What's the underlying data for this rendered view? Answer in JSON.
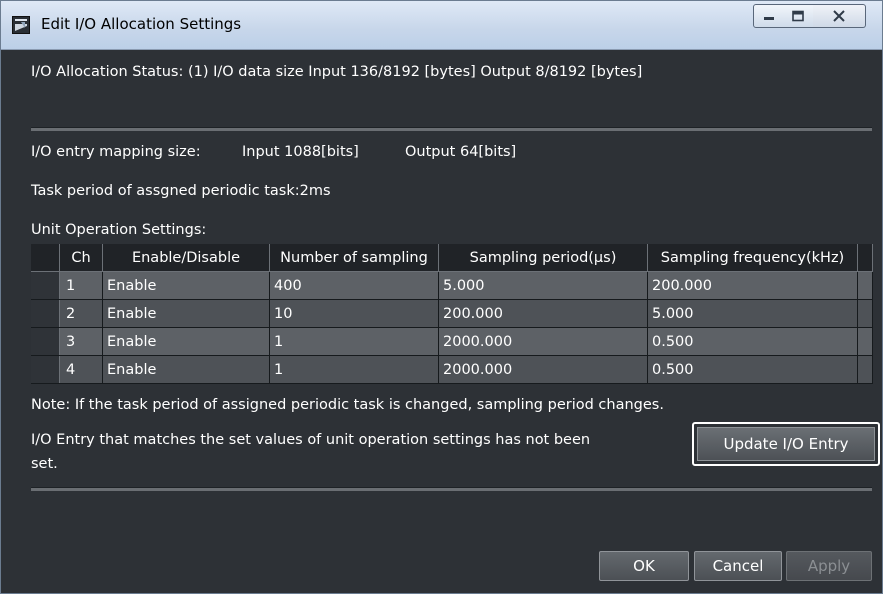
{
  "window": {
    "title": "Edit I/O Allocation Settings",
    "controls": [
      "minimize",
      "maximize",
      "close"
    ]
  },
  "status_line": "I/O Allocation Status: (1) I/O data size Input 136/8192 [bytes] Output 8/8192 [bytes]",
  "mapping": {
    "label": "I/O entry mapping size:",
    "input": "Input 1088[bits]",
    "output": "Output 64[bits]"
  },
  "task_period": "Task period of assgned periodic task:2ms",
  "unit_settings_label": "Unit Operation Settings:",
  "table": {
    "columns": [
      "Ch",
      "Enable/Disable",
      "Number of sampling",
      "Sampling period(μs)",
      "Sampling frequency(kHz)"
    ],
    "rows": [
      {
        "ch": "1",
        "enable": "Enable",
        "samples": "400",
        "period": "5.000",
        "freq": "200.000"
      },
      {
        "ch": "2",
        "enable": "Enable",
        "samples": "10",
        "period": "200.000",
        "freq": "5.000"
      },
      {
        "ch": "3",
        "enable": "Enable",
        "samples": "1",
        "period": "2000.000",
        "freq": "0.500"
      },
      {
        "ch": "4",
        "enable": "Enable",
        "samples": "1",
        "period": "2000.000",
        "freq": "0.500"
      }
    ]
  },
  "note": "Note: If the task period of assigned periodic task is changed, sampling period changes.",
  "entry_warning_line1": "I/O Entry that matches the set values of unit operation settings has not been",
  "entry_warning_line2": "set.",
  "buttons": {
    "update": "Update I/O Entry",
    "ok": "OK",
    "cancel": "Cancel",
    "apply": "Apply"
  }
}
